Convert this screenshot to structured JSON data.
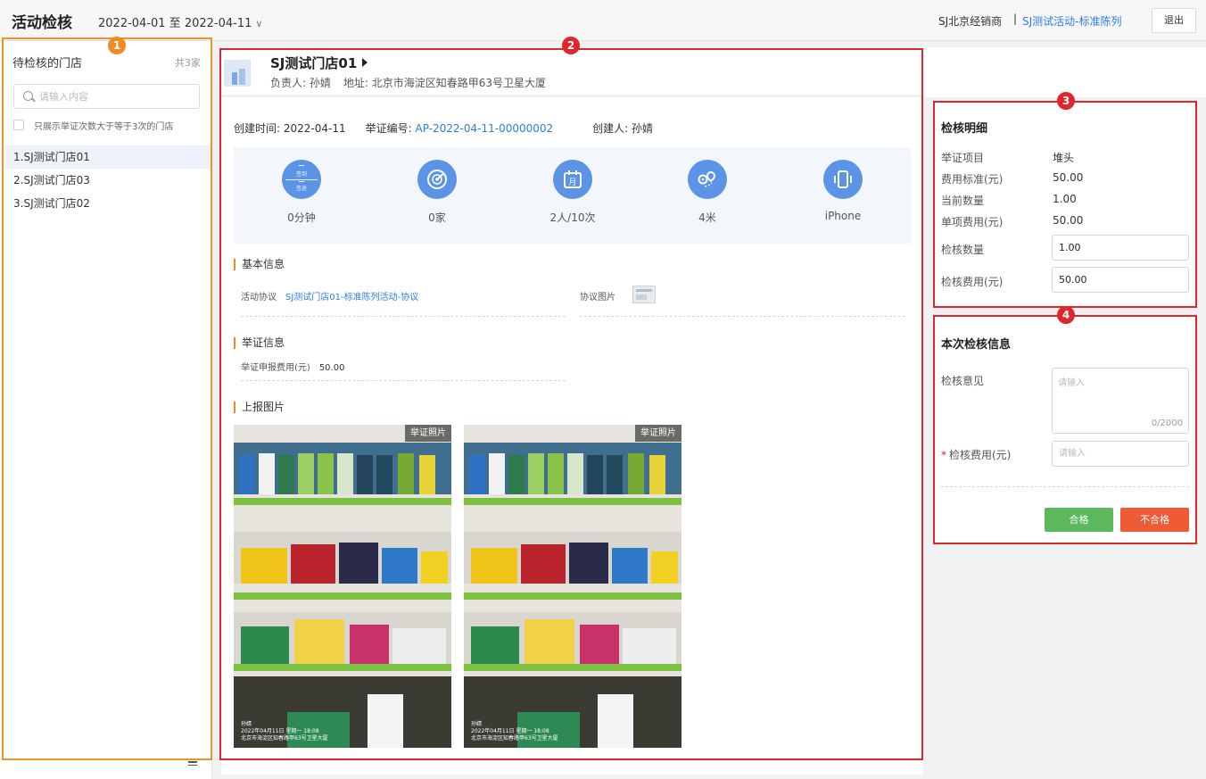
{
  "header": {
    "title": "活动检核",
    "date_range": "2022-04-01 至 2022-04-11",
    "dealer": "SJ北京经销商",
    "separator": "|",
    "activity": "SJ测试活动-标准陈列",
    "logout": "退出"
  },
  "badges": [
    "1",
    "2",
    "3",
    "4"
  ],
  "left": {
    "title": "待检核的门店",
    "count": "共3家",
    "search_placeholder": "请输入内容",
    "filter_label": "只展示举证次数大于等于3次的门店",
    "stores": [
      "1.SJ测试门店01",
      "2.SJ测试门店03",
      "3.SJ测试门店02"
    ]
  },
  "store": {
    "name": "SJ测试门店01",
    "manager": "负责人: 孙婧",
    "address": "地址: 北京市海淀区知春路甲63号卫星大厦"
  },
  "proof": {
    "created_time": "创建时间: 2022-04-11",
    "number_label": "举证编号:",
    "number": "AP-2022-04-11-00000002",
    "creator": "创建人: 孙婧"
  },
  "stats": {
    "sign_in": "签到",
    "sign_out": "签退",
    "calendar_glyph": "月",
    "items": [
      "0分钟",
      "0家",
      "2人/10次",
      "4米",
      "iPhone"
    ]
  },
  "basic_info": {
    "title": "基本信息",
    "agreement_label": "活动协议",
    "agreement_value": "SJ测试门店01-标准陈列活动-协议",
    "agreement_image_label": "协议图片"
  },
  "proof_info": {
    "title": "举证信息",
    "fee_label": "举证申报费用(元)",
    "fee_value": "50.00"
  },
  "photos": {
    "title": "上报图片",
    "tag": "举证照片",
    "caption_name": "孙婧",
    "caption_date": "2022年04月11日 星期一 18:08",
    "caption_address": "北京市海淀区知春路甲63号卫星大厦"
  },
  "detail": {
    "title": "检核明细",
    "rows": [
      {
        "label": "举证项目",
        "value": "堆头"
      },
      {
        "label": "费用标准(元)",
        "value": "50.00"
      },
      {
        "label": "当前数量",
        "value": "1.00"
      },
      {
        "label": "单项费用(元)",
        "value": "50.00"
      }
    ],
    "check_qty_label": "检核数量",
    "check_qty_value": "1.00",
    "check_fee_label": "检核费用(元)",
    "check_fee_value": "50.00"
  },
  "review": {
    "title": "本次检核信息",
    "opinion_label": "检核意见",
    "opinion_placeholder": "请输入",
    "opinion_count": "0/2000",
    "fee_label": "检核费用(元)",
    "fee_placeholder": "请输入",
    "pass_button": "合格",
    "fail_button": "不合格"
  }
}
